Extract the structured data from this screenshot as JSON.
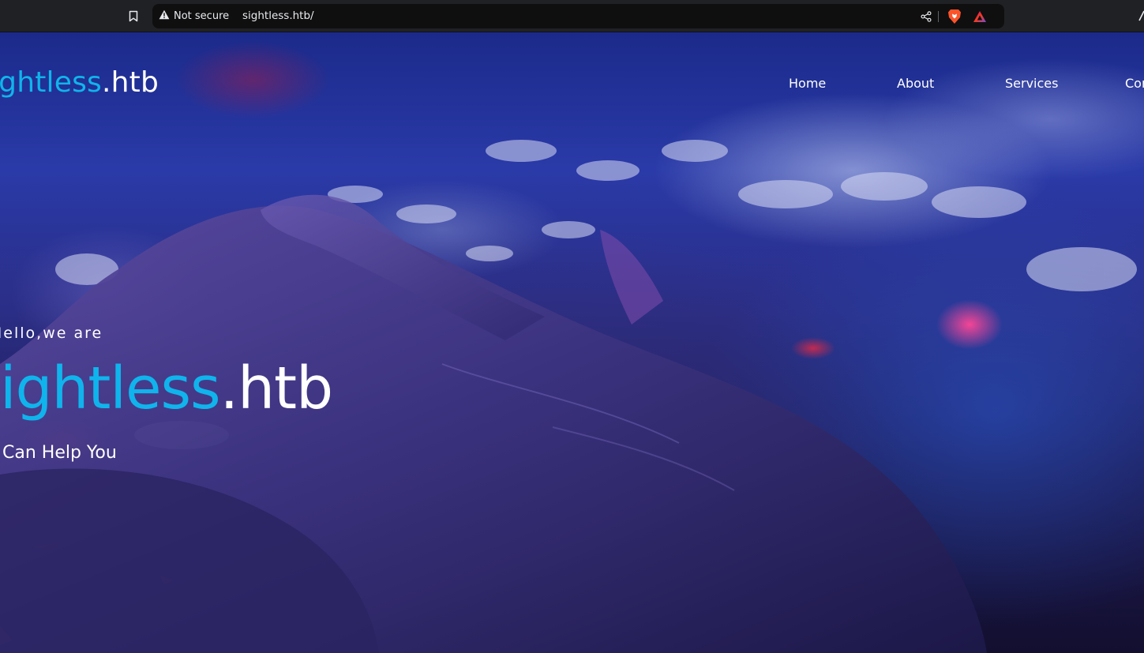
{
  "browser": {
    "security_label": "Not secure",
    "url": "sightless.htb/",
    "icons": {
      "bookmark": "bookmark-icon",
      "warning": "warning-triangle-icon",
      "share": "share-icon",
      "brave": "brave-shields-icon",
      "rewards": "brave-rewards-icon"
    }
  },
  "site": {
    "brand": {
      "accent": "sightless",
      "suffix": ".htb"
    },
    "nav": [
      {
        "label": "Home"
      },
      {
        "label": "About"
      },
      {
        "label": "Services"
      },
      {
        "label": "Contact"
      }
    ],
    "hero": {
      "tagline": "Hello,we are",
      "title_accent": "Sightless",
      "title_suffix": ".htb",
      "subline": "We Can Help You"
    }
  },
  "colors": {
    "accent": "#10b4ec",
    "text": "#ffffff",
    "chrome_bg": "#202124",
    "omnibox_bg": "#0f0f10"
  }
}
